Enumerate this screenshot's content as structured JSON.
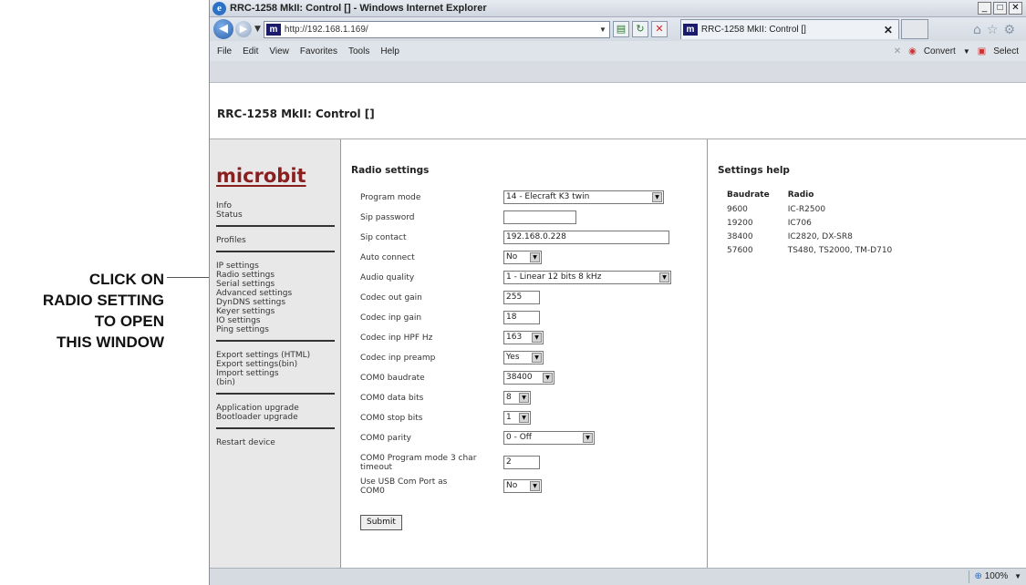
{
  "annotation": {
    "lines": [
      "CLICK ON",
      "RADIO SETTING",
      "TO OPEN",
      "THIS WINDOW"
    ]
  },
  "browser": {
    "window_title": "RRC-1258 MkII: Control [] - Windows Internet Explorer",
    "url": "http://192.168.1.169/",
    "tab_title": "RRC-1258 MkII: Control []",
    "menu": [
      "File",
      "Edit",
      "View",
      "Favorites",
      "Tools",
      "Help"
    ],
    "toolbar_right": {
      "convert": "Convert",
      "select": "Select"
    },
    "zoom": "100%"
  },
  "page": {
    "title": "RRC-1258 MkII: Control []",
    "logo": "microbit",
    "nav": {
      "group1": [
        "Info",
        "Status"
      ],
      "group2": [
        "Profiles"
      ],
      "group3": [
        "IP settings",
        "Radio settings",
        "Serial settings",
        "Advanced settings",
        "DynDNS settings",
        "Keyer settings",
        "IO settings",
        "Ping settings"
      ],
      "group4": [
        "Export settings (HTML)",
        "Export settings(bin)",
        "Import settings (bin)"
      ],
      "group5": [
        "Application upgrade",
        "Bootloader upgrade"
      ],
      "group6": [
        "Restart device"
      ]
    }
  },
  "form": {
    "heading": "Radio settings",
    "fields": [
      {
        "label": "Program mode",
        "value": "14 - Elecraft K3 twin"
      },
      {
        "label": "Sip password",
        "value": ""
      },
      {
        "label": "Sip contact",
        "value": "192.168.0.228"
      },
      {
        "label": "Auto connect",
        "value": "No"
      },
      {
        "label": "Audio quality",
        "value": "1 - Linear 12 bits 8 kHz"
      },
      {
        "label": "Codec out gain",
        "value": "255"
      },
      {
        "label": "Codec inp gain",
        "value": "18"
      },
      {
        "label": "Codec inp HPF Hz",
        "value": "163"
      },
      {
        "label": "Codec inp preamp",
        "value": "Yes"
      },
      {
        "label": "COM0 baudrate",
        "value": "38400"
      },
      {
        "label": "COM0 data bits",
        "value": "8"
      },
      {
        "label": "COM0 stop bits",
        "value": "1"
      },
      {
        "label": "COM0 parity",
        "value": "0 - Off"
      },
      {
        "label": "COM0 Program mode 3 char timeout",
        "value": "2"
      },
      {
        "label": "Use USB Com Port as COM0",
        "value": "No"
      }
    ],
    "submit": "Submit"
  },
  "help": {
    "heading": "Settings help",
    "columns": [
      "Baudrate",
      "Radio"
    ],
    "rows": [
      [
        "9600",
        "IC-R2500"
      ],
      [
        "19200",
        "IC706"
      ],
      [
        "38400",
        "IC2820, DX-SR8"
      ],
      [
        "57600",
        "TS480, TS2000, TM-D710"
      ]
    ]
  }
}
